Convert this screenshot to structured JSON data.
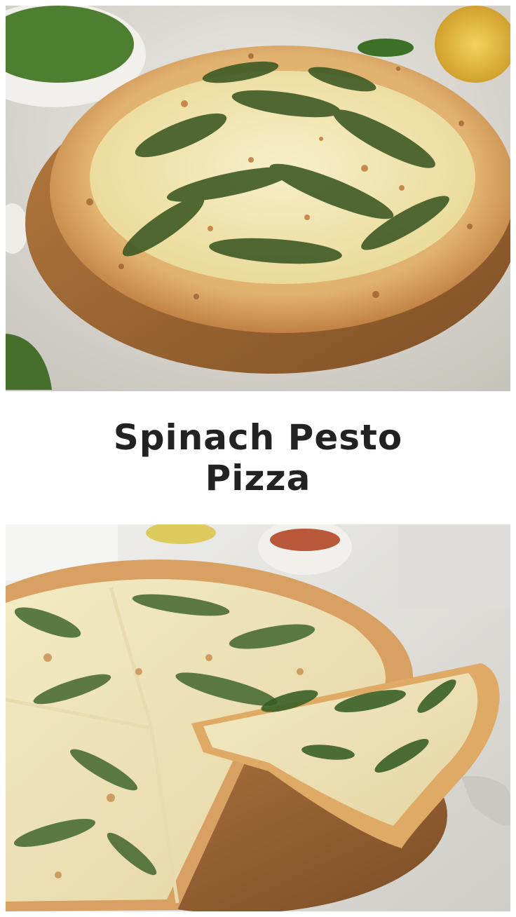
{
  "title": "Spinach Pesto Pizza",
  "photos": {
    "top": {
      "subject": "whole-spinach-pesto-pizza"
    },
    "bottom": {
      "subject": "sliced-spinach-pesto-pizza"
    }
  },
  "colors": {
    "background": "#ffffff",
    "title_text": "#222222",
    "crust": "#d9a45f",
    "cheese": "#efe7b8",
    "pesto": "#3f5a25",
    "board": "#9f6a37",
    "countertop": "#d8d6d0"
  }
}
